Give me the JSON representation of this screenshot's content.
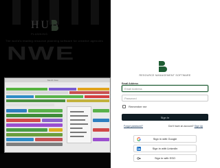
{
  "hero": {
    "logo_text": "HUB",
    "logo_sub": "PLANNING",
    "caption": "The world's leading resource planning software for creative agencies",
    "glyphs": "NWE",
    "screen_title": "Month View"
  },
  "login": {
    "brand_caption": "Resource Management Software",
    "email_label": "Email Address",
    "email_placeholder": "Email Address",
    "password_placeholder": "Password",
    "remember_label": "Remember me",
    "signin_label": "Sign In",
    "forgot_label": "Forgot password?",
    "no_account_text": "Don't have an account?",
    "signup_label": "Sign Up",
    "sso": [
      {
        "label": "Sign in with Google",
        "icon": "google-icon"
      },
      {
        "label": "Sign in with LinkedIn",
        "icon": "linkedin-icon"
      },
      {
        "label": "Sign in with SSO",
        "icon": "key-icon"
      }
    ]
  },
  "colors": {
    "brand_green": "#1f5d34",
    "signin_bg": "#0f1d24",
    "link": "#1d3b5c"
  }
}
